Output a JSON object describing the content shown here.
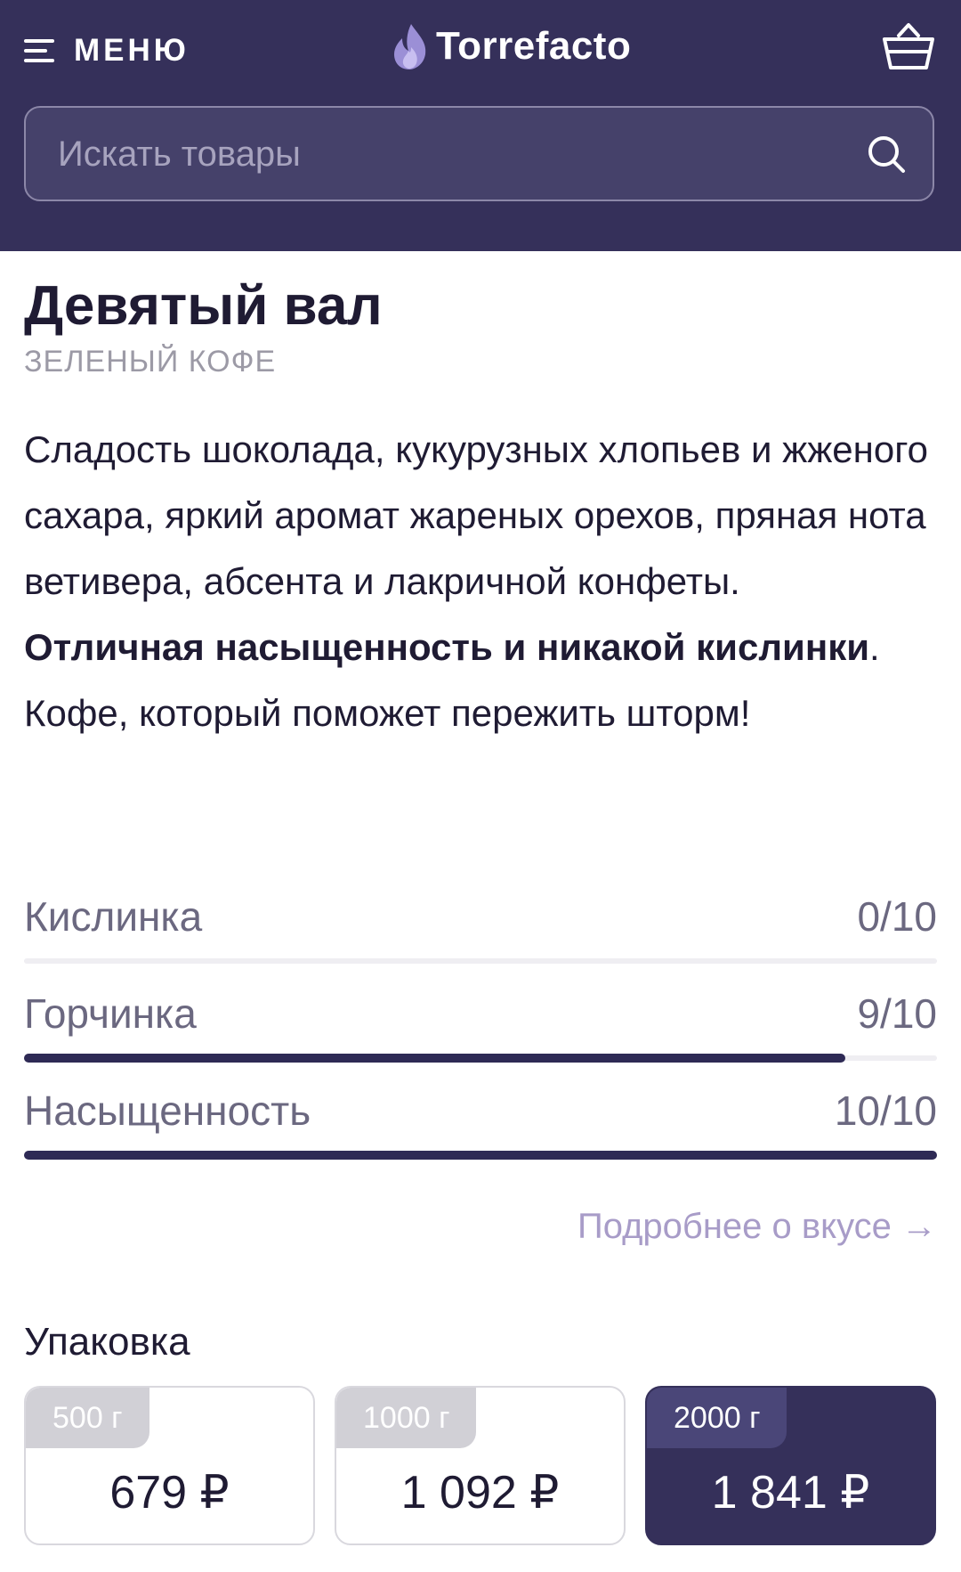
{
  "header": {
    "menu_label": "МЕНЮ",
    "logo_text": "Torrefacto",
    "search_placeholder": "Искать товары"
  },
  "product": {
    "title": "Девятый вал",
    "category": "ЗЕЛЕНЫЙ КОФЕ",
    "description_part1": "Сладость шоколада, кукурузных хлопьев и жженого сахара, яркий аромат жареных орехов, пряная нота ветивера, абсента и лакричной конфеты.",
    "description_bold": "Отличная насыщенность и никакой кислинки",
    "description_period": ".",
    "description_part2": "Кофе, который поможет пережить шторм!"
  },
  "ratings": [
    {
      "label": "Кислинка",
      "value_text": "0/10",
      "score": 0,
      "max": 10
    },
    {
      "label": "Горчинка",
      "value_text": "9/10",
      "score": 9,
      "max": 10
    },
    {
      "label": "Насыщенность",
      "value_text": "10/10",
      "score": 10,
      "max": 10
    }
  ],
  "more_link": "Подробнее о вкусе →",
  "packaging": {
    "title": "Упаковка",
    "options": [
      {
        "weight": "500 г",
        "price": "679 ₽",
        "selected": false
      },
      {
        "weight": "1000 г",
        "price": "1 092 ₽",
        "selected": false
      },
      {
        "weight": "2000 г",
        "price": "1 841 ₽",
        "selected": true
      }
    ]
  },
  "colors": {
    "header_bg": "#35305a",
    "accent_dark": "#2e2a55",
    "link": "#a89cc8",
    "logo_flame": "#9b8fd6"
  }
}
